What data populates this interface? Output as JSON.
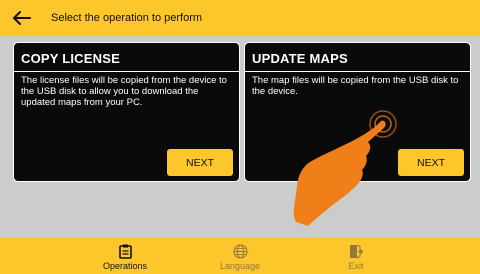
{
  "header": {
    "title": "Select the operation to perform",
    "back_icon": "arrow-left-icon"
  },
  "cards": [
    {
      "title": "COPY LICENSE",
      "text": "The license files will be copied from the device to the USB disk to allow you to download the updated maps from your PC.",
      "button": "NEXT"
    },
    {
      "title": "UPDATE MAPS",
      "text": "The map files will be copied from the USB disk to the device.",
      "button": "NEXT"
    }
  ],
  "footer": {
    "items": [
      {
        "label": "Operations",
        "icon": "clipboard-icon",
        "active": true
      },
      {
        "label": "Language",
        "icon": "globe-icon",
        "active": false
      },
      {
        "label": "Exit",
        "icon": "exit-door-icon",
        "active": false
      }
    ]
  },
  "colors": {
    "accent": "#fdc62b",
    "card": "#0a0a0a",
    "background": "#cccccc",
    "hand": "#f07f1a"
  }
}
